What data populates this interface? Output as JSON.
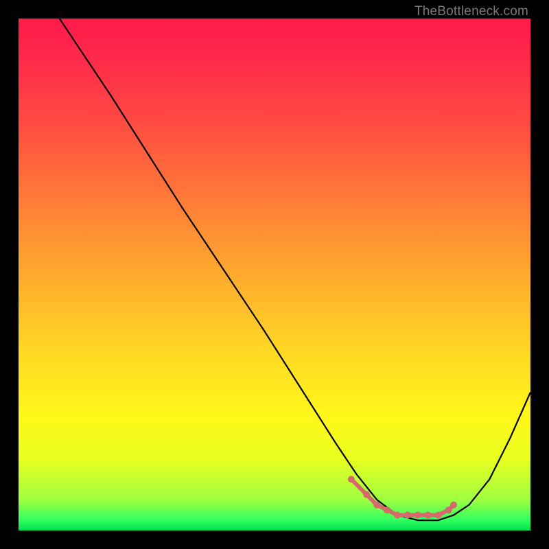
{
  "watermark": "TheBottleneck.com",
  "chart_data": {
    "type": "line",
    "title": "",
    "xlabel": "",
    "ylabel": "",
    "xlim": [
      0,
      100
    ],
    "ylim": [
      0,
      100
    ],
    "series": [
      {
        "name": "bottleneck-curve",
        "x": [
          8,
          12,
          18,
          25,
          32,
          40,
          48,
          55,
          62,
          66,
          70,
          74,
          78,
          82,
          85,
          88,
          92,
          96,
          100
        ],
        "y": [
          100,
          94,
          85,
          74,
          63,
          51,
          39,
          28,
          17,
          11,
          6,
          3,
          2,
          2,
          3,
          5,
          10,
          18,
          27
        ],
        "color": "#000000"
      }
    ],
    "markers": {
      "name": "bottleneck-range",
      "x": [
        65,
        68,
        70,
        72,
        74,
        76,
        78,
        80,
        82,
        84,
        85
      ],
      "y": [
        10,
        7,
        5,
        4,
        3,
        3,
        3,
        3,
        3,
        4,
        5
      ],
      "color": "#d46a6a"
    },
    "background_gradient": {
      "stops": [
        {
          "pos": 0,
          "color": "#ff1a4a"
        },
        {
          "pos": 20,
          "color": "#ff4a42"
        },
        {
          "pos": 50,
          "color": "#ffaa2e"
        },
        {
          "pos": 78,
          "color": "#fff81a"
        },
        {
          "pos": 94,
          "color": "#a0ff40"
        },
        {
          "pos": 100,
          "color": "#00e050"
        }
      ]
    }
  }
}
